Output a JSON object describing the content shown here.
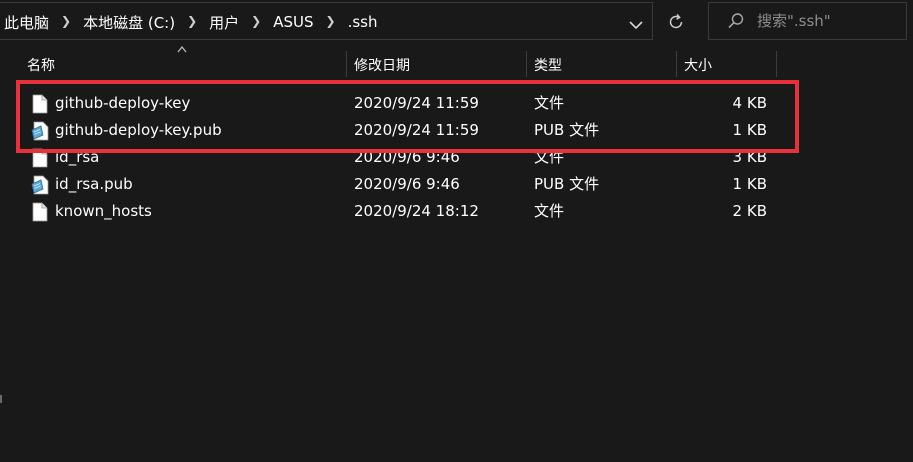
{
  "breadcrumbs": [
    "此电脑",
    "本地磁盘 (C:)",
    "用户",
    "ASUS",
    ".ssh"
  ],
  "search": {
    "placeholder": "搜索\".ssh\""
  },
  "columns": {
    "name": "名称",
    "date": "修改日期",
    "type": "类型",
    "size": "大小"
  },
  "files": [
    {
      "name": "github-deploy-key",
      "date": "2020/9/24 11:59",
      "type": "文件",
      "size": "4 KB",
      "icon": "blank-file-icon"
    },
    {
      "name": "github-deploy-key.pub",
      "date": "2020/9/24 11:59",
      "type": "PUB 文件",
      "size": "1 KB",
      "icon": "pub-file-icon"
    },
    {
      "name": "id_rsa",
      "date": "2020/9/6 9:46",
      "type": "文件",
      "size": "3 KB",
      "icon": "blank-file-icon"
    },
    {
      "name": "id_rsa.pub",
      "date": "2020/9/6 9:46",
      "type": "PUB 文件",
      "size": "1 KB",
      "icon": "pub-file-icon"
    },
    {
      "name": "known_hosts",
      "date": "2020/9/24 18:12",
      "type": "文件",
      "size": "2 KB",
      "icon": "blank-file-icon"
    }
  ],
  "colors": {
    "background": "#191919",
    "text": "#ffffff",
    "highlight": "#e8323b",
    "border": "#3a3a3a"
  }
}
